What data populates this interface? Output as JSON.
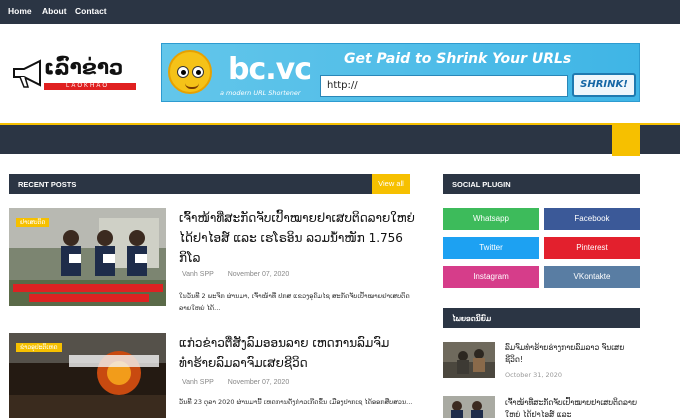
{
  "topnav": {
    "items": [
      "Home",
      "About",
      "Contact"
    ]
  },
  "logo": {
    "text": "ເລົ່າຂ່າວ",
    "sub": "LAOKHAO"
  },
  "banner": {
    "brand": "bc.vc",
    "tagline": "a modern URL Shortener",
    "headline": "Get Paid to Shrink Your URLs",
    "input_value": "http://",
    "button": "SHRINK!"
  },
  "recent": {
    "heading": "RECENT POSTS",
    "view_all": "View all",
    "posts": [
      {
        "tag": "ຢາເສບຕິດ",
        "title": "ເຈົ້າໜ້າທີ່ສະກັດຈັບເປົ້າໝາຍຢາເສບຕິດລາຍໃຫຍ່ ໄດ້ຢາໄອສ໌ ແລະ ເຮໂຣອິນ ລວມນ້ຳໜັກ 1.756 ກິໂລ",
        "author": "Vanh SPP",
        "date": "November 07, 2020",
        "excerpt": "ໃນວັນທີ 2 ພະຈິກ ຜ່ານມາ, ເຈົ້າໜ້າທີ່ ປກສ ແຂວງອຸດົມໄຊ ສະກັດຈັບເປົ້າໝາຍຢາເສບຕິດລາຍໃຫຍ່ ໄດ້..."
      },
      {
        "tag": "ຂ່າວອຸປະຕິເຫດ",
        "title": "ແກ່ວຂ່າວຕື່ສັງລົມອອນລາຍ ເຫດການລົມຈົມທຳຮ້າຍລົມລາຈົມເສຍຊີວິດ",
        "author": "Vanh SPP",
        "date": "November 07, 2020",
        "excerpt": "ວັນທີ 23 ຕຸລາ 2020 ຜ່ານມານີ້ ເຫດການດັ່ງກ່າວເກີດຂຶ້ນ ເມືອງປາກເຊ ໄດ້ອອກສືບສວນ..."
      }
    ]
  },
  "social": {
    "heading": "SOCIAL PLUGIN",
    "buttons": [
      {
        "label": "Whatsapp",
        "color": "#3dbb5b"
      },
      {
        "label": "Facebook",
        "color": "#3b5998"
      },
      {
        "label": "Twitter",
        "color": "#1da1f2"
      },
      {
        "label": "Pinterest",
        "color": "#e3202d"
      },
      {
        "label": "Instagram",
        "color": "#d63d8a"
      },
      {
        "label": "VKontakte",
        "color": "#597da3"
      }
    ]
  },
  "popular": {
    "heading": "ໄພຍອດນິຍົມ",
    "posts": [
      {
        "title": "ລົມຈົມທຳຮ້າຍຮ່າງກາຍລົມລາວ ຈົນເສຍຊີວິດ!",
        "date": "October 31, 2020"
      },
      {
        "title": "ເຈົ້າໜ້າທີ່ສະກັດຈັບເປົ້າໝາຍຢາເສບຕິດລາຍໃຫຍ່ ໄດ້ຢາໄອສ໌ ແລະ",
        "date": ""
      }
    ]
  },
  "colors": {
    "dark": "#2b3544",
    "accent": "#f6c000"
  }
}
